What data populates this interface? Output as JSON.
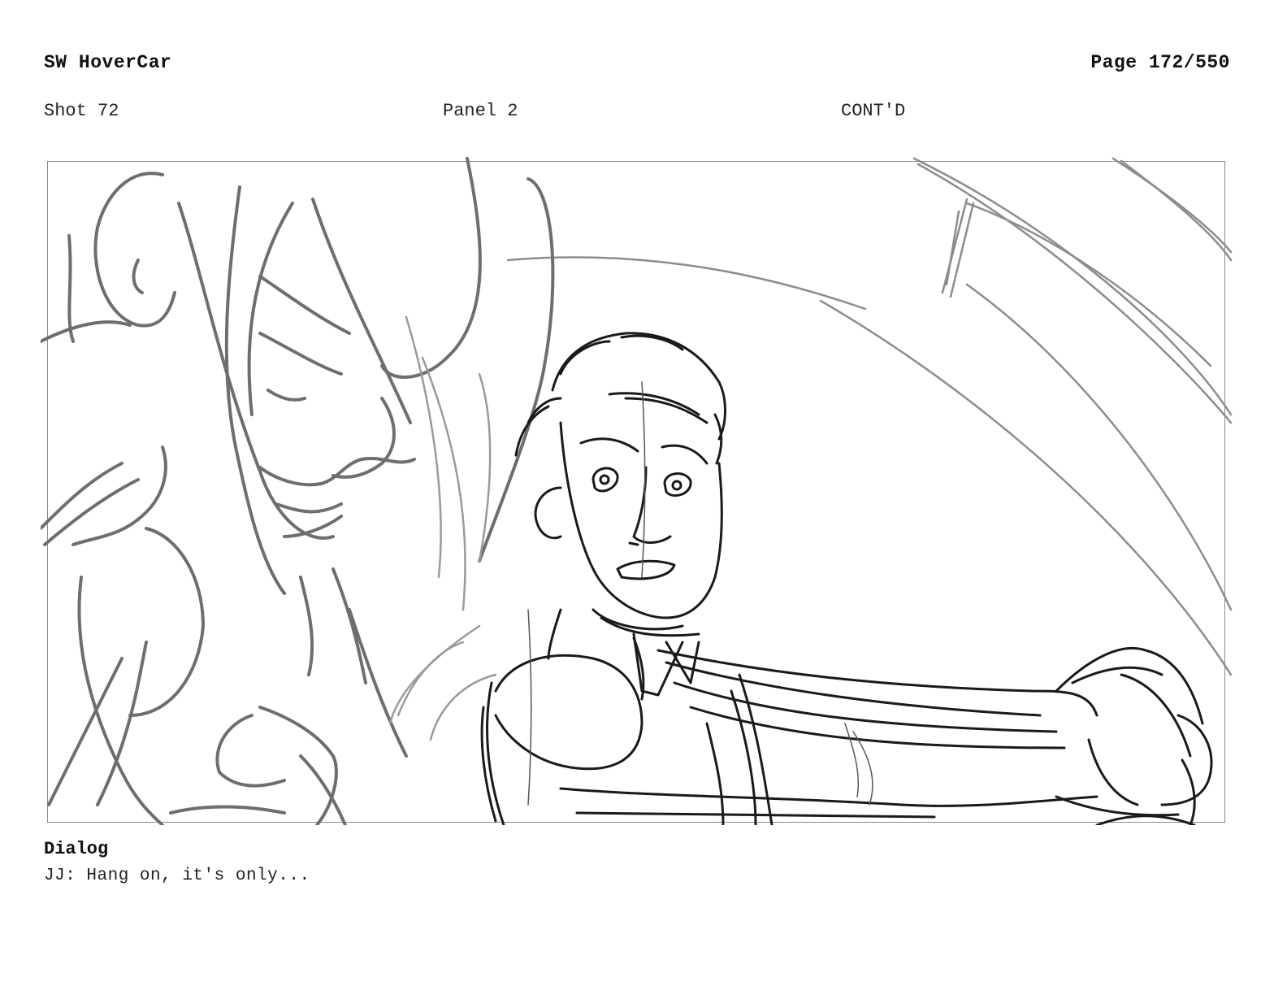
{
  "header": {
    "title": "SW HoverCar",
    "page": "Page 172/550"
  },
  "shot_info": {
    "shot": "Shot 72",
    "panel": "Panel 2",
    "cont": "CONT'D"
  },
  "dialog": {
    "label": "Dialog",
    "text": "JJ: Hang on, it's only..."
  },
  "colors": {
    "ink_dark": "#1a1a1a",
    "ink_light": "#6e6e6e",
    "frame_border": "#8a8a8a"
  }
}
